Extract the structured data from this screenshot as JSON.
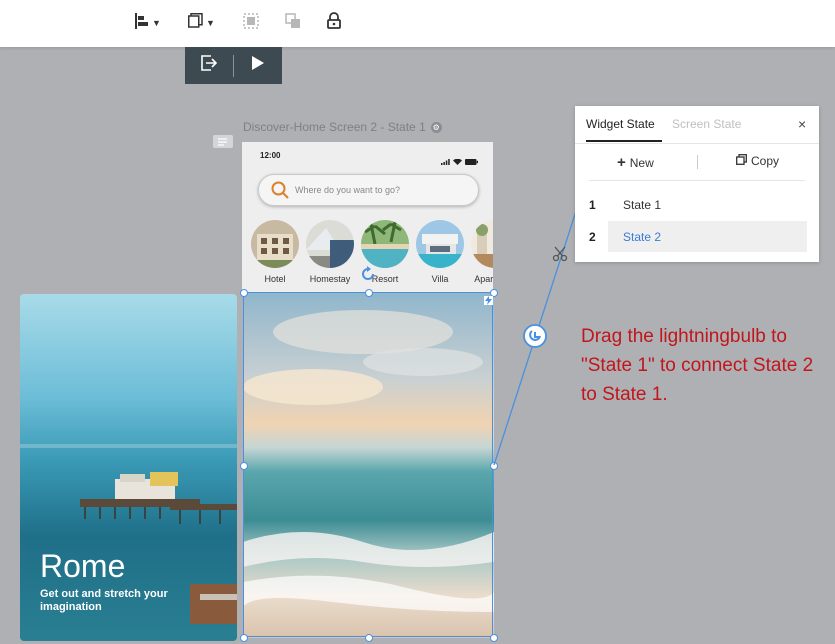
{
  "toolbar": {
    "items": [
      "align-icon",
      "layer-icon",
      "group-icon",
      "ungroup-icon",
      "lock-icon"
    ]
  },
  "preview": {
    "items": [
      "exit-preview-icon",
      "play-icon"
    ]
  },
  "canvas": {
    "title": "Discover-Home Screen 2 - State 1",
    "phone": {
      "time": "12:00",
      "search_placeholder": "Where do you want to go?",
      "categories": [
        "Hotel",
        "Homestay",
        "Resort",
        "Villa",
        "Apartment"
      ]
    },
    "card": {
      "title": "Rome",
      "subtitle": "Get out and stretch your imagination"
    }
  },
  "widget_state_panel": {
    "tab_active": "Widget State",
    "tab_inactive": "Screen State",
    "close": "×",
    "new_label": "New",
    "copy_label": "Copy",
    "states": [
      {
        "num": "1",
        "name": "State 1",
        "selected": false
      },
      {
        "num": "2",
        "name": "State 2",
        "selected": true
      }
    ]
  },
  "instruction": "Drag the lightningbulb to \"State 1\" to connect State 2 to State 1.",
  "colors": {
    "instruction_red": "#c0161c",
    "selection_blue": "#4a90e2",
    "selected_state_text": "#3a7ad6",
    "canvas_bg": "#aeb0b3"
  }
}
